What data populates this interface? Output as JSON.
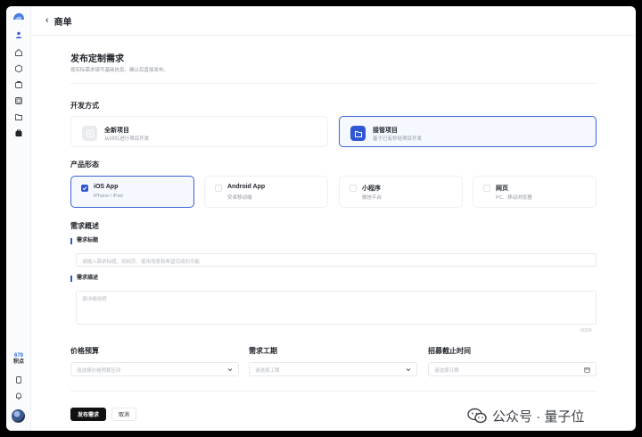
{
  "topbar": {
    "title": "商单"
  },
  "page": {
    "heading": "发布定制需求",
    "subheading": "按实际需求填写基础信息，确认后直接发布。"
  },
  "sidebar": {
    "points_value": "679",
    "points_label": "积点"
  },
  "dev_mode": {
    "section_title": "开发方式",
    "options": [
      {
        "title": "全新项目",
        "desc": "从0到1进行项目开发",
        "selected": false
      },
      {
        "title": "接管项目",
        "desc": "基于已有秒哒项目开发",
        "selected": true
      }
    ]
  },
  "product_form": {
    "section_title": "产品形态",
    "options": [
      {
        "title": "iOS App",
        "desc": "iPhone / iPad",
        "checked": true
      },
      {
        "title": "Android App",
        "desc": "安卓移动端",
        "checked": false
      },
      {
        "title": "小程序",
        "desc": "微信平台",
        "checked": false
      },
      {
        "title": "网页",
        "desc": "PC、移动浏览器",
        "checked": false
      }
    ]
  },
  "overview": {
    "section_title": "需求概述",
    "title_label": "需求标题",
    "title_placeholder": "请输入需求标题，如网页、使用场景和希望完成的功能",
    "desc_label": "需求描述",
    "desc_placeholder": "请详细说明",
    "desc_counter": "0/200"
  },
  "fields": [
    {
      "label": "价格预算",
      "placeholder": "请选择价格预算区间",
      "icon": "chevron-down-icon"
    },
    {
      "label": "需求工期",
      "placeholder": "请选择工期",
      "icon": "chevron-down-icon"
    },
    {
      "label": "招募截止时间",
      "placeholder": "请选择日期",
      "icon": "calendar-icon"
    }
  ],
  "actions": {
    "submit": "发布需求",
    "cancel": "取消"
  },
  "watermark": {
    "text": "公众号 · 量子位"
  },
  "colors": {
    "accent": "#2f57d4",
    "primary_button": "#111111"
  }
}
